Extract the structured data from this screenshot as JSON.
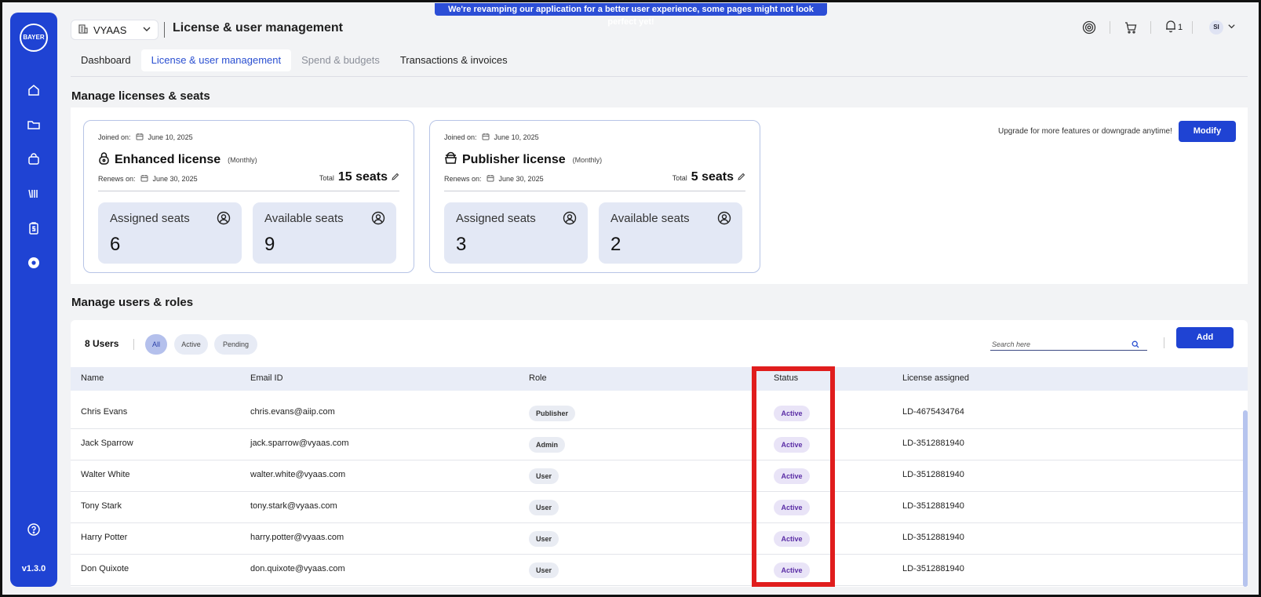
{
  "banner": "We're revamping our application for a better user experience, some pages might not look perfect yet!",
  "sidebar": {
    "logo_text": "BAYER",
    "version": "v1.3.0",
    "nav_icons": [
      "home-icon",
      "folder-icon",
      "bag-icon",
      "library-icon",
      "clipboard-dollar-icon",
      "settings-icon"
    ],
    "footer_icon": "help-icon"
  },
  "header": {
    "workspace": "VYAAS",
    "title": "License & user management",
    "notification_count": "1",
    "avatar_initials": "SI"
  },
  "tabs": [
    {
      "label": "Dashboard"
    },
    {
      "label": "License & user management"
    },
    {
      "label": "Spend & budgets"
    },
    {
      "label": "Transactions & invoices"
    }
  ],
  "licenses": {
    "section_title": "Manage licenses & seats",
    "upgrade_text": "Upgrade for more features or downgrade anytime!",
    "modify_label": "Modify",
    "cards": [
      {
        "joined_label": "Joined on:",
        "joined_date": "June 10, 2025",
        "title": "Enhanced license",
        "period": "(Monthly)",
        "renews_label": "Renews on:",
        "renews_date": "June 30, 2025",
        "total_label": "Total",
        "total_seats": "15 seats",
        "assigned_label": "Assigned seats",
        "assigned": "6",
        "available_label": "Available seats",
        "available": "9"
      },
      {
        "joined_label": "Joined on:",
        "joined_date": "June 10, 2025",
        "title": "Publisher license",
        "period": "(Monthly)",
        "renews_label": "Renews on:",
        "renews_date": "June 30, 2025",
        "total_label": "Total",
        "total_seats": "5 seats",
        "assigned_label": "Assigned seats",
        "assigned": "3",
        "available_label": "Available seats",
        "available": "2"
      }
    ]
  },
  "users": {
    "section_title": "Manage users & roles",
    "count_label": "8 Users",
    "filters": [
      "All",
      "Active",
      "Pending"
    ],
    "search_placeholder": "Search here",
    "add_label": "Add",
    "columns": [
      "Name",
      "Email ID",
      "Role",
      "Status",
      "License assigned"
    ],
    "rows": [
      {
        "name": "Chris Evans",
        "email": "chris.evans@aiip.com",
        "role": "Publisher",
        "status": "Active",
        "license": "LD-4675434764"
      },
      {
        "name": "Jack Sparrow",
        "email": "jack.sparrow@vyaas.com",
        "role": "Admin",
        "status": "Active",
        "license": "LD-3512881940"
      },
      {
        "name": "Walter White",
        "email": "walter.white@vyaas.com",
        "role": "User",
        "status": "Active",
        "license": "LD-3512881940"
      },
      {
        "name": "Tony Stark",
        "email": "tony.stark@vyaas.com",
        "role": "User",
        "status": "Active",
        "license": "LD-3512881940"
      },
      {
        "name": "Harry Potter",
        "email": "harry.potter@vyaas.com",
        "role": "User",
        "status": "Active",
        "license": "LD-3512881940"
      },
      {
        "name": "Don Quixote",
        "email": "don.quixote@vyaas.com",
        "role": "User",
        "status": "Active",
        "license": "LD-3512881940"
      }
    ]
  },
  "colors": {
    "brand": "#1f43d3",
    "highlight": "#e01d1d",
    "status_text": "#5b2ea6"
  }
}
